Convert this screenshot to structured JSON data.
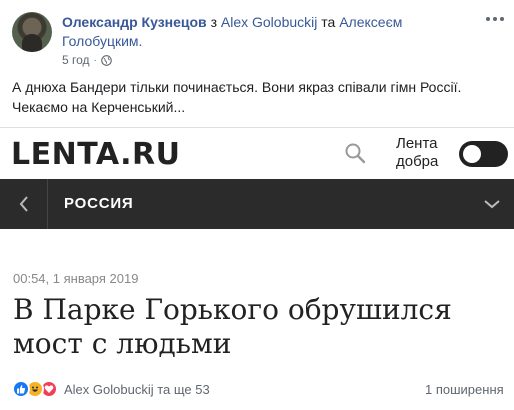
{
  "post": {
    "author": "Олександр Кузнецов",
    "with_word": "з",
    "tag1": "Alex Golobuckij",
    "and_word": "та",
    "tag2": "Алексеєм Голобуцким.",
    "time": "5 год",
    "dot": "·",
    "text": "А днюха Бандери тільки починається. Вони якраз співали гімн Россії. Чекаємо на Керченський..."
  },
  "card": {
    "logo": "LENTA.RU",
    "dobra_line1": "Лента",
    "dobra_line2": "добра",
    "section": "РОССИЯ",
    "date": "00:54, 1 января 2019",
    "title": "В Парке Горького обрушился мост с людьми"
  },
  "footer": {
    "reaction_names": "Alex Golobuckij та ще 53",
    "shares": "1 поширення"
  },
  "icons": {
    "globe": "globe-icon",
    "more": "more-options-icon",
    "search": "search-icon",
    "back": "chevron-left-icon",
    "expand": "chevron-down-icon",
    "like": "like-reaction-icon",
    "haha": "haha-reaction-icon",
    "love": "love-reaction-icon"
  },
  "colors": {
    "link": "#385898",
    "nav_bg": "#2b2b2b",
    "like": "#1877f2",
    "haha": "#f7b125",
    "love": "#f33e58"
  }
}
